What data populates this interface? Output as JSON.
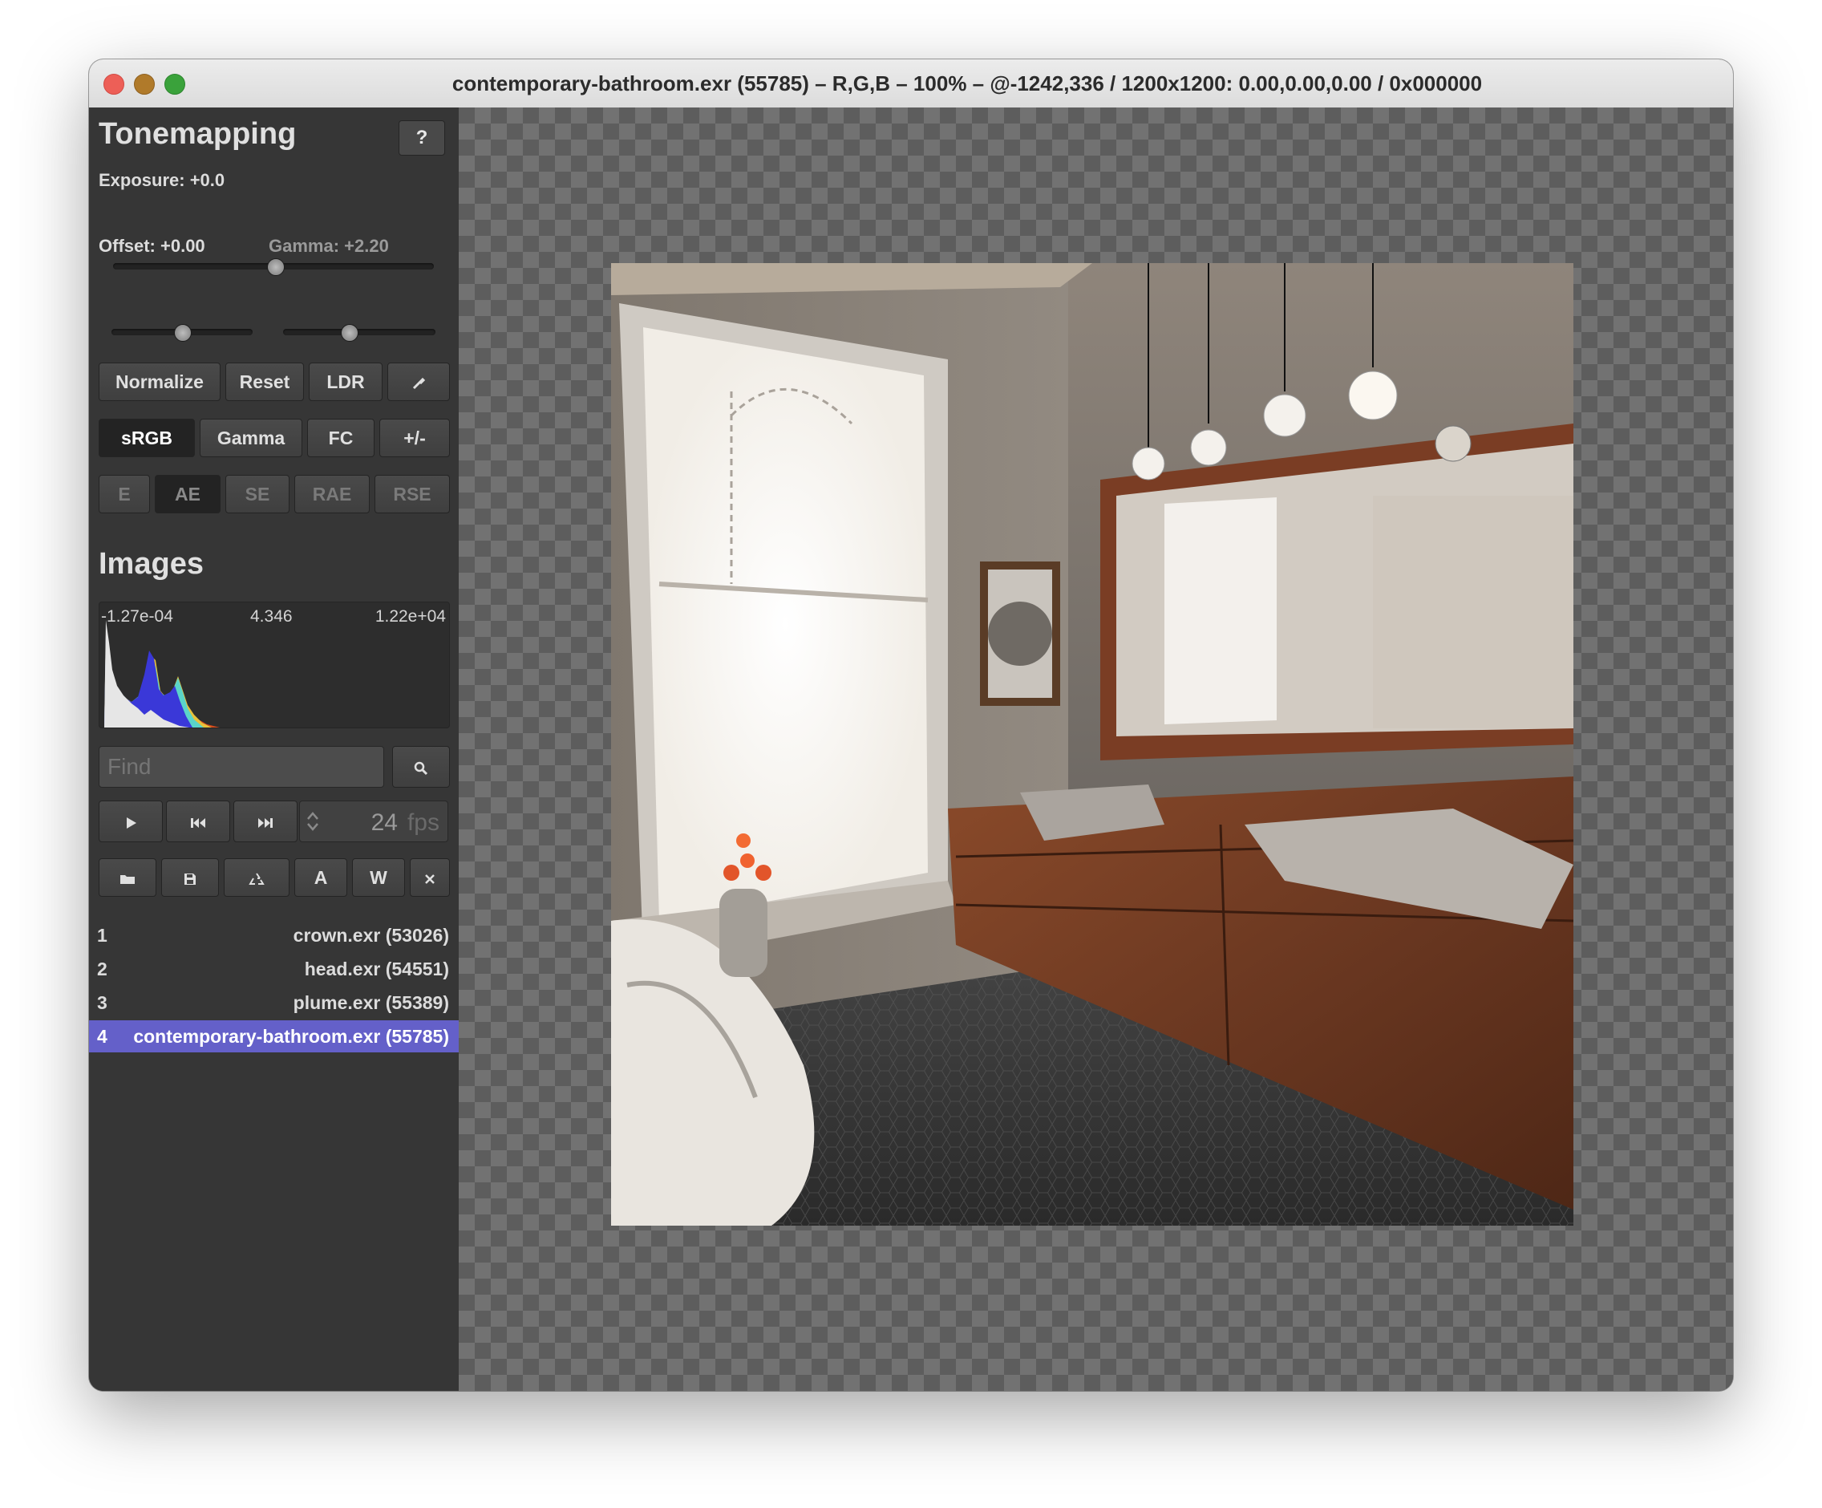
{
  "window": {
    "title": "contemporary-bathroom.exr (55785) – R,G,B – 100% – @-1242,336 / 1200x1200: 0.00,0.00,0.00 / 0x000000"
  },
  "tonemapping": {
    "heading": "Tonemapping",
    "help_label": "?",
    "exposure_label": "Exposure: +0.0",
    "exposure_value": 0.0,
    "offset_label": "Offset: +0.00",
    "offset_value": 0.0,
    "gamma_label": "Gamma: +2.20",
    "gamma_value": 2.2,
    "buttons": {
      "normalize": "Normalize",
      "reset": "Reset",
      "ldr": "LDR",
      "dropper_icon": "eyedropper-icon"
    },
    "tonemap_modes": [
      "sRGB",
      "Gamma",
      "FC",
      "+/-"
    ],
    "tonemap_selected": "sRGB",
    "error_modes": [
      "E",
      "AE",
      "SE",
      "RAE",
      "RSE"
    ],
    "error_selected": "AE"
  },
  "images": {
    "heading": "Images",
    "histogram": {
      "min": "-1.27e-04",
      "mid": "4.346",
      "max": "1.22e+04"
    },
    "find_placeholder": "Find",
    "search_icon": "magnifier-icon",
    "playback": {
      "fps_value": "24",
      "fps_unit": "fps",
      "icons": [
        "play-icon",
        "skip-back-icon",
        "skip-forward-icon"
      ]
    },
    "file_buttons": {
      "open_icon": "folder-icon",
      "save_icon": "floppy-icon",
      "reload_icon": "recycle-icon",
      "a_label": "A",
      "w_label": "W",
      "close_icon": "close-icon"
    },
    "list": [
      {
        "num": "1",
        "name": "crown.exr (53026)"
      },
      {
        "num": "2",
        "name": "head.exr (54551)"
      },
      {
        "num": "3",
        "name": "plume.exr (55389)"
      },
      {
        "num": "4",
        "name": "contemporary-bathroom.exr (55785)",
        "selected": true
      }
    ]
  },
  "colors": {
    "selection": "#6460c9",
    "sidebar": "#363636"
  }
}
